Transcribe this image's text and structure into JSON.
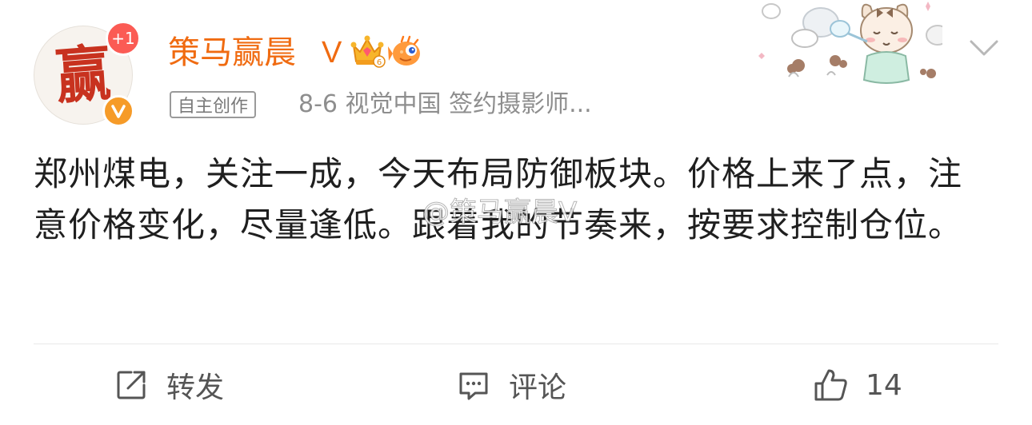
{
  "post": {
    "author": {
      "name": "策马赢晨",
      "vip_label": "V",
      "avatar_char": "赢",
      "notification_badge": "+1",
      "verified_icon": "verified-v-icon",
      "badges": [
        "crown-level-icon",
        "pufferfish-icon"
      ]
    },
    "meta": {
      "tag": "自主创作",
      "date_and_source": "8-6  视觉中国 签约摄影师..."
    },
    "content": "郑州煤电，关注一成，今天布局防御板块。价格上来了点，注意价格变化，尽量逢低。跟着我的节奏来，按要求控制仓位。",
    "watermark": "@策马赢晨V",
    "actions": {
      "repost": {
        "label": "转发",
        "icon": "repost-icon"
      },
      "comment": {
        "label": "评论",
        "icon": "comment-icon"
      },
      "like": {
        "count": "14",
        "icon": "thumbs-up-icon"
      }
    }
  },
  "colors": {
    "username": "#f06b11",
    "notification": "#fb5b54",
    "verified": "#f69b28",
    "text": "#1f1f1f",
    "meta": "#8e8e8e"
  }
}
